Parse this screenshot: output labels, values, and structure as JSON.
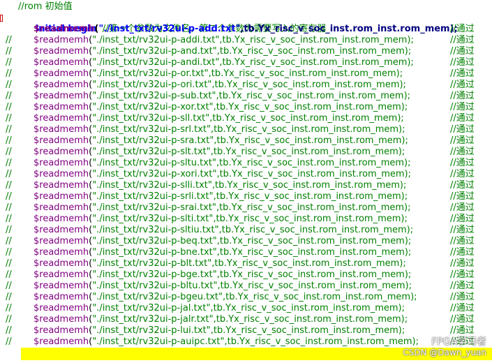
{
  "header": {
    "comment": "//rom 初始值",
    "keyword": "initial begin",
    "keyword_comment": "//第一个参数为文件名，第二个参数为需要写入的寄存器"
  },
  "lines": [
    {
      "prefix": "",
      "fn": "$readmemh",
      "file": "\"./inst_txt/rv32ui-p-add.txt\"",
      "args": ",tb.Yx_risc_v_soc_inst.rom_inst.rom_mem);",
      "comment": "//通过",
      "active": true
    },
    {
      "prefix": "//",
      "fn": "$readmemh",
      "file": "\"./inst_txt/rv32ui-p-addi.txt\"",
      "args": ",tb.Yx_risc_v_soc_inst.rom_inst.rom_mem);",
      "comment": "//通过",
      "active": false
    },
    {
      "prefix": "//",
      "fn": "$readmemh",
      "file": "\"./inst_txt/rv32ui-p-and.txt\"",
      "args": ",tb.Yx_risc_v_soc_inst.rom_inst.rom_mem);",
      "comment": "//通过",
      "active": false
    },
    {
      "prefix": "//",
      "fn": "$readmemh",
      "file": "\"./inst_txt/rv32ui-p-andi.txt\"",
      "args": ",tb.Yx_risc_v_soc_inst.rom_inst.rom_mem);",
      "comment": "//通过",
      "active": false
    },
    {
      "prefix": "//",
      "fn": "$readmemh",
      "file": "\"./inst_txt/rv32ui-p-or.txt\"",
      "args": ",tb.Yx_risc_v_soc_inst.rom_inst.rom_mem);",
      "comment": "//通过",
      "active": false
    },
    {
      "prefix": "//",
      "fn": "$readmemh",
      "file": "\"./inst_txt/rv32ui-p-ori.txt\"",
      "args": ",tb.Yx_risc_v_soc_inst.rom_inst.rom_mem);",
      "comment": "//通过",
      "active": false
    },
    {
      "prefix": "//",
      "fn": "$readmemh",
      "file": "\"./inst_txt/rv32ui-p-sub.txt\"",
      "args": ",tb.Yx_risc_v_soc_inst.rom_inst.rom_mem);",
      "comment": "//通过",
      "active": false
    },
    {
      "prefix": "//",
      "fn": "$readmemh",
      "file": "\"./inst_txt/rv32ui-p-xor.txt\"",
      "args": ",tb.Yx_risc_v_soc_inst.rom_inst.rom_mem);",
      "comment": "//通过",
      "active": false
    },
    {
      "prefix": "//",
      "fn": "$readmemh",
      "file": "\"./inst_txt/rv32ui-p-sll.txt\"",
      "args": ",tb.Yx_risc_v_soc_inst.rom_inst.rom_mem);",
      "comment": "//通过",
      "active": false
    },
    {
      "prefix": "//",
      "fn": "$readmemh",
      "file": "\"./inst_txt/rv32ui-p-srl.txt\"",
      "args": ",tb.Yx_risc_v_soc_inst.rom_inst.rom_mem);",
      "comment": "//通过",
      "active": false
    },
    {
      "prefix": "//",
      "fn": "$readmemh",
      "file": "\"./inst_txt/rv32ui-p-sra.txt\"",
      "args": ",tb.Yx_risc_v_soc_inst.rom_inst.rom_mem);",
      "comment": "//通过",
      "active": false
    },
    {
      "prefix": "//",
      "fn": "$readmemh",
      "file": "\"./inst_txt/rv32ui-p-slt.txt\"",
      "args": ",tb.Yx_risc_v_soc_inst.rom_inst.rom_mem);",
      "comment": "//通过",
      "active": false
    },
    {
      "prefix": "//",
      "fn": "$readmemh",
      "file": "\"./inst_txt/rv32ui-p-sltu.txt\"",
      "args": ",tb.Yx_risc_v_soc_inst.rom_inst.rom_mem);",
      "comment": "//通过",
      "active": false
    },
    {
      "prefix": "//",
      "fn": "$readmemh",
      "file": "\"./inst_txt/rv32ui-p-xori.txt\"",
      "args": ",tb.Yx_risc_v_soc_inst.rom_inst.rom_mem);",
      "comment": "//通过",
      "active": false
    },
    {
      "prefix": "//",
      "fn": "$readmemh",
      "file": "\"./inst_txt/rv32ui-p-slli.txt\"",
      "args": ",tb.Yx_risc_v_soc_inst.rom_inst.rom_mem);",
      "comment": "//通过",
      "active": false
    },
    {
      "prefix": "//",
      "fn": "$readmemh",
      "file": "\"./inst_txt/rv32ui-p-srli.txt\"",
      "args": ",tb.Yx_risc_v_soc_inst.rom_inst.rom_mem);",
      "comment": "//通过",
      "active": false
    },
    {
      "prefix": "//",
      "fn": "$readmemh",
      "file": "\"./inst_txt/rv32ui-p-srai.txt\"",
      "args": ",tb.Yx_risc_v_soc_inst.rom_inst.rom_mem);",
      "comment": "//通过",
      "active": false
    },
    {
      "prefix": "//",
      "fn": "$readmemh",
      "file": "\"./inst_txt/rv32ui-p-slti.txt\"",
      "args": ",tb.Yx_risc_v_soc_inst.rom_inst.rom_mem);",
      "comment": "//通过",
      "active": false
    },
    {
      "prefix": "//",
      "fn": "$readmemh",
      "file": "\"./inst_txt/rv32ui-p-sltiu.txt\"",
      "args": ",tb.Yx_risc_v_soc_inst.rom_inst.rom_mem);",
      "comment": "//通过",
      "active": false
    },
    {
      "prefix": "//",
      "fn": "$readmemh",
      "file": "\"./inst_txt/rv32ui-p-beq.txt\"",
      "args": ",tb.Yx_risc_v_soc_inst.rom_inst.rom_mem);",
      "comment": "//通过",
      "active": false
    },
    {
      "prefix": "//",
      "fn": "$readmemh",
      "file": "\"./inst_txt/rv32ui-p-bne.txt\"",
      "args": ",tb.Yx_risc_v_soc_inst.rom_inst.rom_mem);",
      "comment": "//通过",
      "active": false
    },
    {
      "prefix": "//",
      "fn": "$readmemh",
      "file": "\"./inst_txt/rv32ui-p-blt.txt\"",
      "args": ",tb.Yx_risc_v_soc_inst.rom_inst.rom_mem);",
      "comment": "//通过",
      "active": false
    },
    {
      "prefix": "//",
      "fn": "$readmemh",
      "file": "\"./inst_txt/rv32ui-p-bge.txt\"",
      "args": ",tb.Yx_risc_v_soc_inst.rom_inst.rom_mem);",
      "comment": "//通过",
      "active": false
    },
    {
      "prefix": "//",
      "fn": "$readmemh",
      "file": "\"./inst_txt/rv32ui-p-bltu.txt\"",
      "args": ",tb.Yx_risc_v_soc_inst.rom_inst.rom_mem);",
      "comment": "//通过",
      "active": false
    },
    {
      "prefix": "//",
      "fn": "$readmemh",
      "file": "\"./inst_txt/rv32ui-p-bgeu.txt\"",
      "args": ",tb.Yx_risc_v_soc_inst.rom_inst.rom_mem);",
      "comment": "//通过",
      "active": false
    },
    {
      "prefix": "//",
      "fn": "$readmemh",
      "file": "\"./inst_txt/rv32ui-p-jal.txt\"",
      "args": ",tb.Yx_risc_v_soc_inst.rom_inst.rom_mem);",
      "comment": "//通过",
      "active": false
    },
    {
      "prefix": "//",
      "fn": "$readmemh",
      "file": "\"./inst_txt/rv32ui-p-jalr.txt\"",
      "args": ",tb.Yx_risc_v_soc_inst.rom_inst.rom_mem);",
      "comment": "//通过",
      "active": false
    },
    {
      "prefix": "//",
      "fn": "$readmemh",
      "file": "\"./inst_txt/rv32ui-p-lui.txt\"",
      "args": ",tb.Yx_risc_v_soc_inst.rom_inst.rom_mem);",
      "comment": "//通过",
      "active": false
    },
    {
      "prefix": "//",
      "fn": "$readmemh",
      "file": "\"./inst_txt/rv32ui-p-auipc.txt\"",
      "args": ",tb.Yx_risc_v_soc_inst.rom_inst.rom_mem);",
      "comment": "//通过",
      "active": false
    }
  ],
  "watermark": {
    "main": "FPGA学习者",
    "sub": "CSDN @Dawn_yuan"
  },
  "colors": {
    "comment": "#008000",
    "keyword": "#0000ff",
    "function": "#800080",
    "highlight": "#ffff00"
  }
}
